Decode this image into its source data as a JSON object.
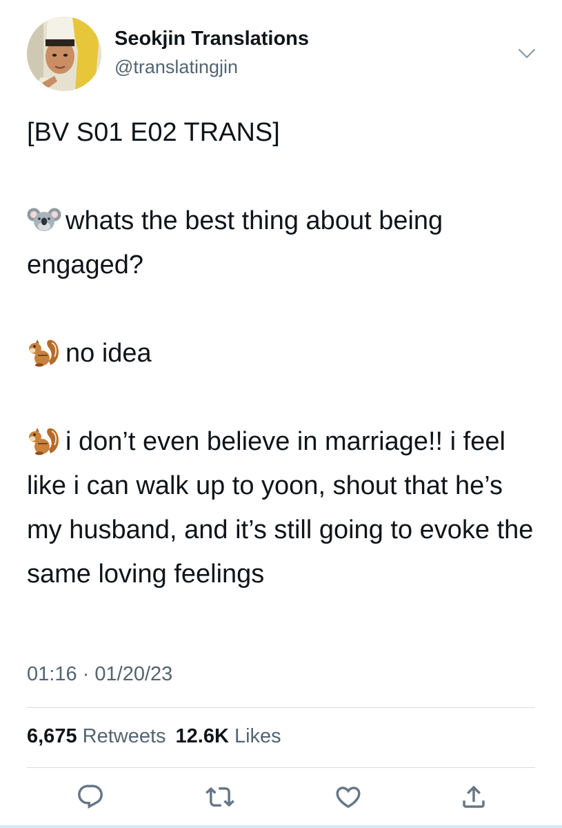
{
  "author": {
    "display_name": "Seokjin Translations",
    "handle": "@translatingjin"
  },
  "tweet": {
    "header": "[BV S01 E02 TRANS]",
    "lines": [
      {
        "emoji": "koala-emoji",
        "text": "whats the best thing about being engaged?"
      },
      {
        "emoji": "chipmunk-emoji",
        "text": "no idea"
      },
      {
        "emoji": "chipmunk-emoji",
        "text": "i don’t even believe in marriage!! i feel like i can walk up to yoon, shout that he’s my husband, and it’s still going to evoke the same loving feelings"
      }
    ],
    "time": "01:16",
    "separator": "·",
    "date": "01/20/23"
  },
  "stats": {
    "retweets_count": "6,675",
    "retweets_label": "Retweets",
    "likes_count": "12.6K",
    "likes_label": "Likes"
  },
  "actions": [
    "reply-icon",
    "retweet-icon",
    "like-icon",
    "share-icon"
  ],
  "colors": {
    "text": "#0f1419",
    "secondary": "#536471",
    "divider": "#d5dbe0",
    "icon": "#657786"
  }
}
